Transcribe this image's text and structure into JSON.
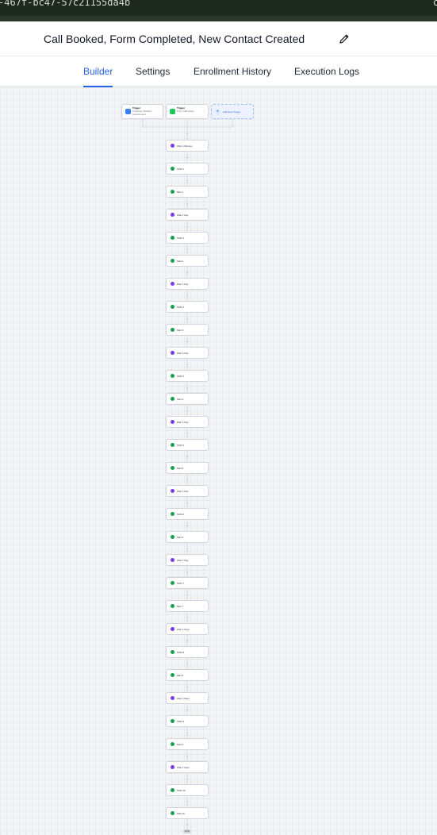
{
  "browser": {
    "url_fragment": "-467f-bc47-57c21155da4b"
  },
  "header": {
    "title": "Call Booked, Form Completed, New Contact Created"
  },
  "tabs": [
    {
      "label": "Builder",
      "active": true
    },
    {
      "label": "Settings",
      "active": false
    },
    {
      "label": "Enrollment History",
      "active": false
    },
    {
      "label": "Execution Logs",
      "active": false
    }
  ],
  "triggers": [
    {
      "heading": "Trigger",
      "label": "Customer Booked Appointment",
      "icon": "calendar-icon",
      "color": "#3b82f6"
    },
    {
      "heading": "Trigger",
      "label": "Form Submitted",
      "icon": "form-icon",
      "color": "#22c55e"
    }
  ],
  "add_trigger": {
    "label": "Add New Trigger"
  },
  "colors": {
    "accent": "#2563eb",
    "wait": "#7c3aed",
    "sms": "#16a34a"
  },
  "actions": [
    {
      "label": "Wait 1 Minutes",
      "type": "wait"
    },
    {
      "label": "SMS 1",
      "type": "sms"
    },
    {
      "label": "Mail 1",
      "type": "email"
    },
    {
      "label": "Wait 1 Day",
      "type": "wait"
    },
    {
      "label": "SMS 2",
      "type": "sms"
    },
    {
      "label": "Mail 2",
      "type": "email"
    },
    {
      "label": "Wait 1 Day",
      "type": "wait"
    },
    {
      "label": "SMS 3",
      "type": "sms"
    },
    {
      "label": "Mail 3",
      "type": "email"
    },
    {
      "label": "Wait 1 Day",
      "type": "wait"
    },
    {
      "label": "SMS 4",
      "type": "sms"
    },
    {
      "label": "Mail 4",
      "type": "email"
    },
    {
      "label": "Wait 1 Day",
      "type": "wait"
    },
    {
      "label": "SMS 5",
      "type": "sms"
    },
    {
      "label": "Mail 5",
      "type": "email"
    },
    {
      "label": "Wait 1 Day",
      "type": "wait"
    },
    {
      "label": "SMS 6",
      "type": "sms"
    },
    {
      "label": "Mail 6",
      "type": "email"
    },
    {
      "label": "Wait 1 Day",
      "type": "wait"
    },
    {
      "label": "SMS 7",
      "type": "sms"
    },
    {
      "label": "Mail 7",
      "type": "email"
    },
    {
      "label": "Wait 1 Days",
      "type": "wait"
    },
    {
      "label": "SMS 8",
      "type": "sms"
    },
    {
      "label": "Mail 8",
      "type": "email"
    },
    {
      "label": "Wait 1 Days",
      "type": "wait"
    },
    {
      "label": "SMS 9",
      "type": "sms"
    },
    {
      "label": "Mail 9",
      "type": "email"
    },
    {
      "label": "Wait 1 Days",
      "type": "wait"
    },
    {
      "label": "SMS 10",
      "type": "sms"
    },
    {
      "label": "Mail 10",
      "type": "email"
    }
  ],
  "end_label": "END"
}
